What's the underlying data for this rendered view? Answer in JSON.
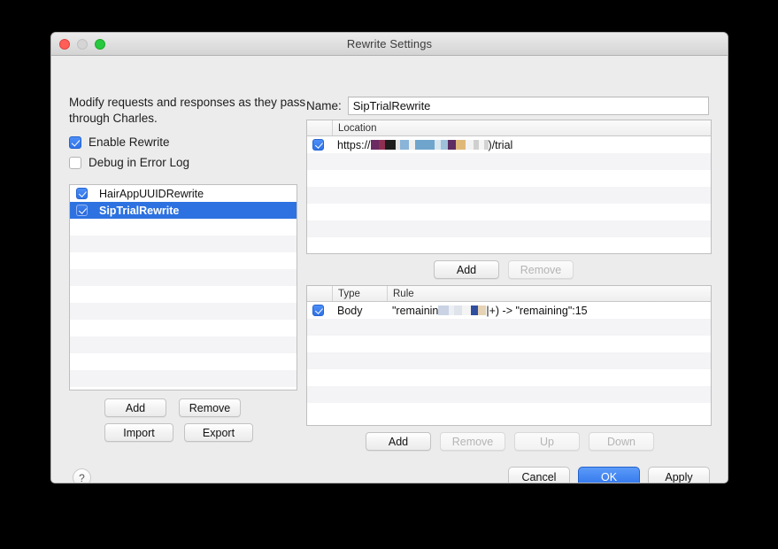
{
  "window": {
    "title": "Rewrite Settings",
    "traffic_lights": [
      "close-button",
      "minimize-button",
      "zoom-button"
    ]
  },
  "left_panel": {
    "intro_text": "Modify requests and responses as they pass through Charles.",
    "checkboxes": [
      {
        "label": "Enable Rewrite",
        "checked": true
      },
      {
        "label": "Debug in Error Log",
        "checked": false
      }
    ],
    "rule_sets": [
      {
        "label": "HairAppUUIDRewrite",
        "checked": true,
        "selected": false
      },
      {
        "label": "SipTrialRewrite",
        "checked": true,
        "selected": true
      }
    ],
    "buttons": {
      "add": "Add",
      "remove": "Remove",
      "import": "Import",
      "export": "Export"
    },
    "help_label": "?"
  },
  "right_panel": {
    "name_label": "Name:",
    "name_value": "SipTrialRewrite",
    "location_table": {
      "columns": [
        "",
        "Location"
      ],
      "rows": [
        {
          "checked": true,
          "prefix": "https://",
          "redacted": true,
          "suffix": ")/trial"
        }
      ]
    },
    "location_buttons": {
      "add": "Add",
      "remove": "Remove",
      "remove_disabled": true
    },
    "rule_table": {
      "columns": [
        "",
        "Type",
        "Rule"
      ],
      "rows": [
        {
          "checked": true,
          "type": "Body",
          "rule_prefix": "\"remainin",
          "redacted": true,
          "rule_suffix": "|+) -> \"remaining\":15"
        }
      ]
    },
    "rule_buttons": [
      {
        "label": "Add",
        "disabled": false
      },
      {
        "label": "Remove",
        "disabled": true
      },
      {
        "label": "Up",
        "disabled": true
      },
      {
        "label": "Down",
        "disabled": true
      }
    ]
  },
  "dialog_buttons": [
    {
      "label": "Cancel",
      "default": false
    },
    {
      "label": "OK",
      "default": true
    },
    {
      "label": "Apply",
      "default": false
    }
  ],
  "colors": {
    "accent": "#2f74ec",
    "selection": "#2d72e0",
    "window_bg": "#ececec",
    "desktop_bg": "#000000"
  }
}
